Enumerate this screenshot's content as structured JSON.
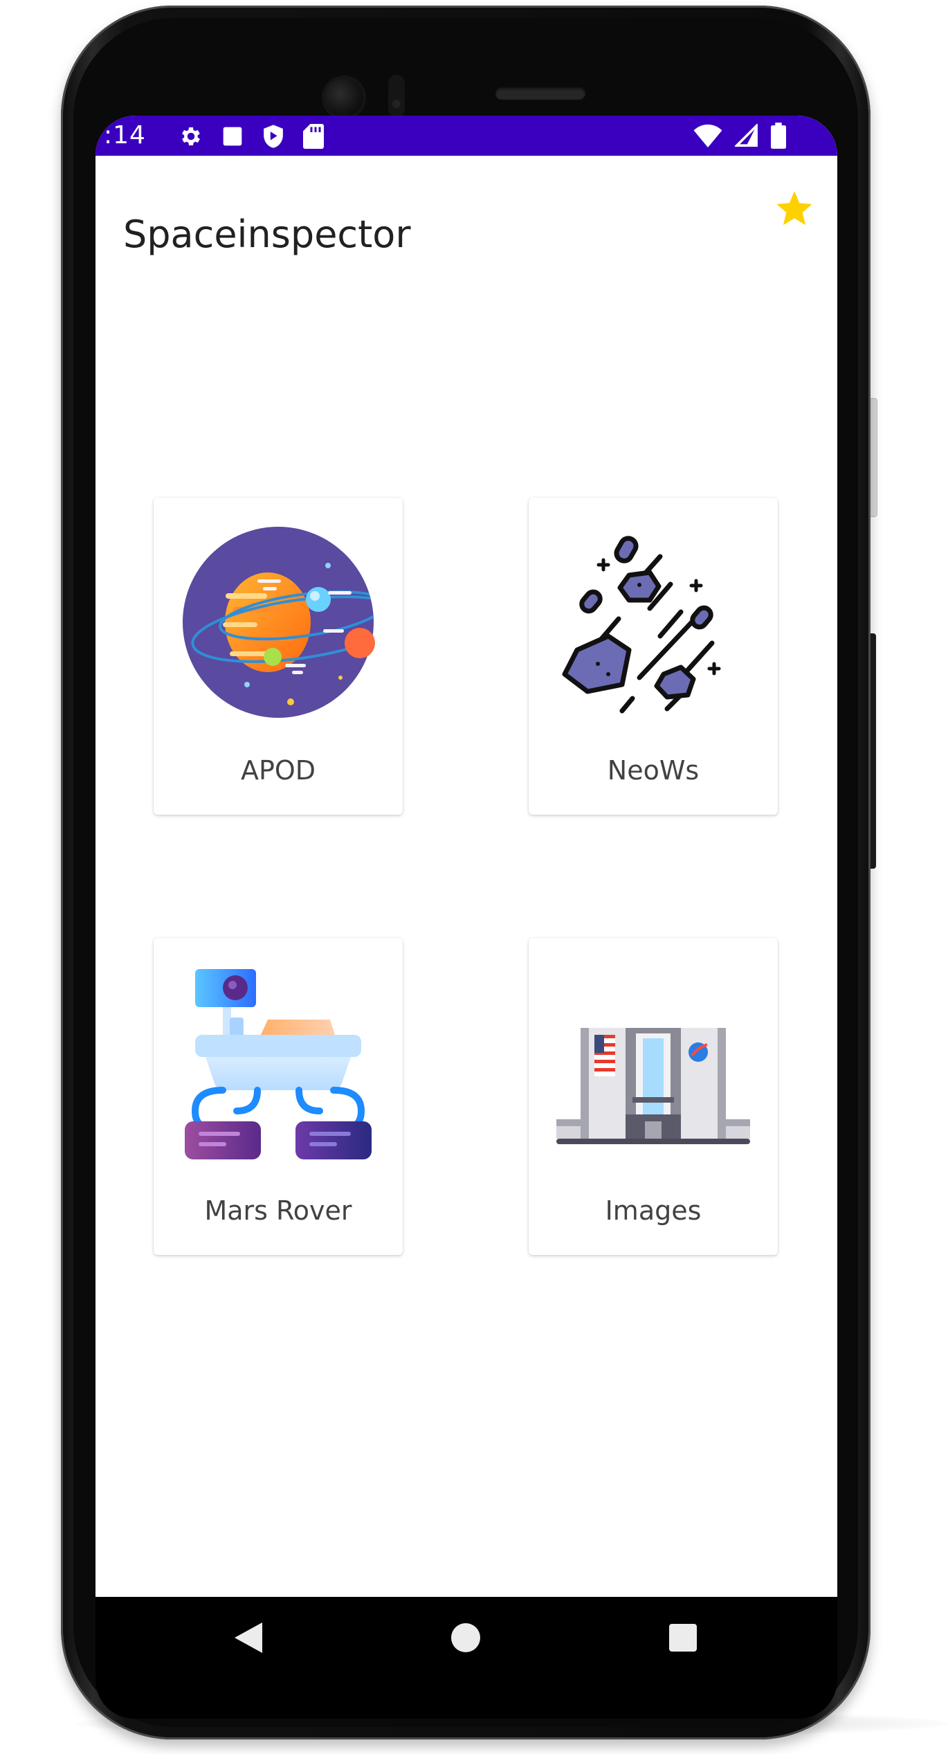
{
  "status_bar": {
    "time": ":14",
    "left_icons": [
      "gear-icon",
      "square-notification-icon",
      "shield-play-icon",
      "sd-card-icon"
    ],
    "right_icons": [
      "wifi-icon",
      "cell-signal-icon",
      "battery-icon"
    ],
    "color": "#3b00bf"
  },
  "app_bar": {
    "title": "Spaceinspector",
    "favorite_icon": "star-icon",
    "favorite_color": "#ffd000"
  },
  "cards": [
    {
      "label": "APOD",
      "icon": "solar-system-icon"
    },
    {
      "label": "NeoWs",
      "icon": "asteroids-icon"
    },
    {
      "label": "Mars Rover",
      "icon": "mars-rover-icon"
    },
    {
      "label": "Images",
      "icon": "nasa-building-icon"
    }
  ],
  "nav_bar": {
    "back": "back-triangle-icon",
    "home": "home-circle-icon",
    "recents": "recents-square-icon"
  }
}
